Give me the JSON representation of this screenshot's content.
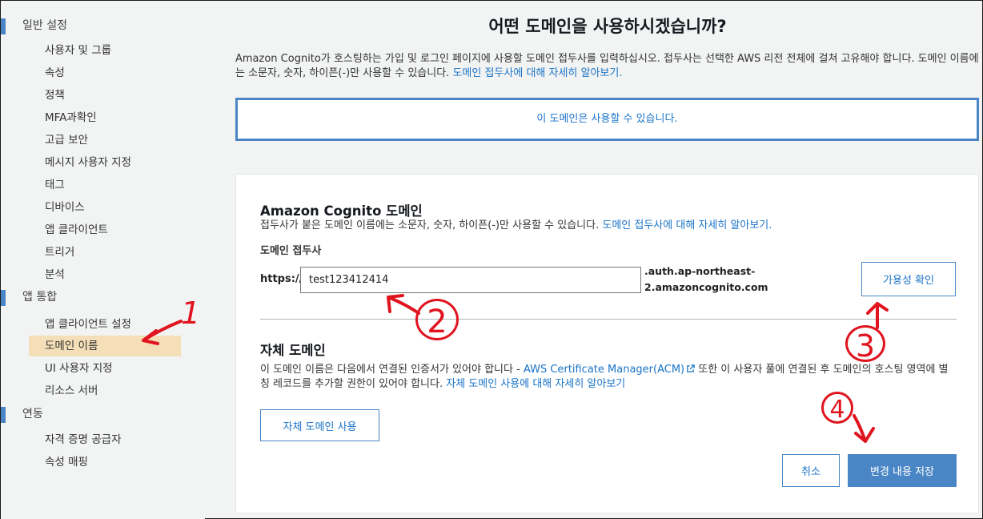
{
  "sidebar": {
    "sections": [
      {
        "label": "일반 설정",
        "items": [
          "사용자 및 그룹",
          "속성",
          "정책",
          "MFA과확인",
          "고급 보안",
          "메시지 사용자 지정",
          "태그",
          "디바이스",
          "앱 클라이언트",
          "트리거",
          "분석"
        ]
      },
      {
        "label": "앱 통합",
        "items": [
          "앱 클라이언트 설정",
          "도메인 이름",
          "UI 사용자 지정",
          "리소스 서버"
        ]
      },
      {
        "label": "연동",
        "items": [
          "자격 증명 공급자",
          "속성 매핑"
        ]
      }
    ],
    "active_item": "도메인 이름"
  },
  "main": {
    "title": "어떤 도메인을 사용하시겠습니까?",
    "description": "Amazon Cognito가 호스팅하는 가입 및 로그인 페이지에 사용할 도메인 접두사를 입력하십시오. 접두사는 선택한 AWS 리전 전체에 걸쳐 고유해야 합니다. 도메인 이름에는 소문자, 숫자, 하이픈(-)만 사용할 수 있습니다.",
    "description_link": "도메인 접두사에 대해 자세히 알아보기.",
    "availability_message": "이 도메인은 사용할 수 있습니다."
  },
  "cognito_domain": {
    "heading": "Amazon Cognito 도메인",
    "help_text": "접두사가 붙은 도메인 이름에는 소문자, 숫자, 하이픈(-)만 사용할 수 있습니다.",
    "help_link": "도메인 접두사에 대해 자세히 알아보기.",
    "field_label": "도메인 접두사",
    "prefix": "https://",
    "input_value": "test123412414",
    "suffix_line1": ".auth.ap-northeast-",
    "suffix_line2": "2.amazoncognito.com",
    "check_button": "가용성 확인"
  },
  "custom_domain": {
    "heading": "자체 도메인",
    "text_before": "이 도메인 이름은 다음에서 연결된 인증서가 있어야 합니다 -",
    "acm_link": "AWS Certificate Manager(ACM)",
    "text_after": "또한 이 사용자 풀에 연결된 후 도메인의 호스팅 영역에 별칭 레코드를 추가할 권한이 있어야 합니다.",
    "help_link": "자체 도메인 사용에 대해 자세히 알아보기",
    "use_button": "자체 도메인 사용"
  },
  "actions": {
    "cancel": "취소",
    "save": "변경 내용 저장"
  },
  "annotations": [
    "1",
    "2",
    "3",
    "4"
  ],
  "colors": {
    "accent": "#4a86c5",
    "link": "#1a73c7",
    "active_bg": "#f5dfb8",
    "annotation": "#e0141e"
  }
}
